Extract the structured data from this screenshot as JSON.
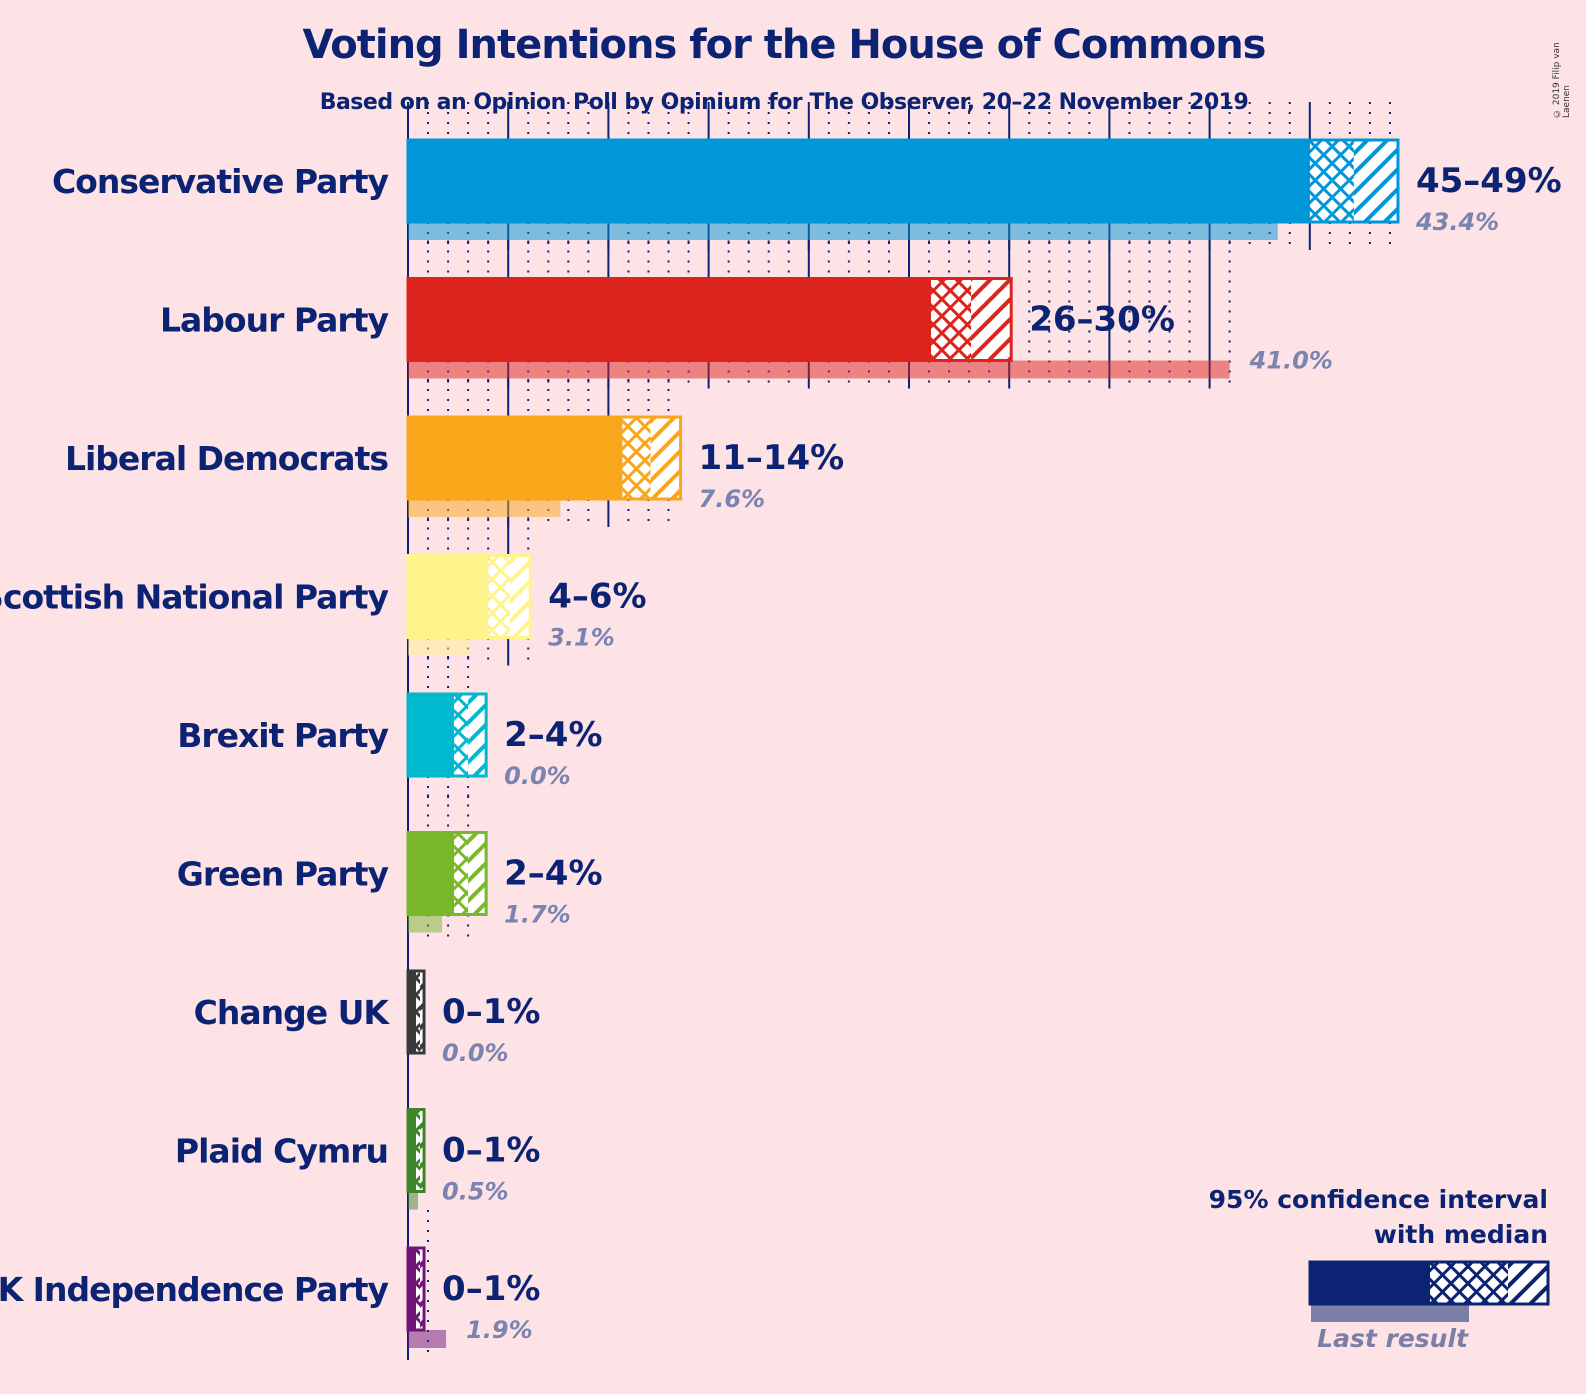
{
  "title": "Voting Intentions for the House of Commons",
  "subtitle": "Based on an Opinion Poll by Opinium for The Observer, 20–22 November 2019",
  "copyright": "© 2019 Filip van Laenen",
  "legend": {
    "title_line1": "95% confidence interval",
    "title_line2": "with median",
    "last_result": "Last result"
  },
  "chart_data": {
    "type": "bar",
    "orientation": "horizontal",
    "xlim": [
      0,
      50
    ],
    "grid": "dotted every 1%, solid every 5%",
    "series": [
      {
        "party": "Conservative Party",
        "color": "#0096d8",
        "low": 45.0,
        "median": 47.2,
        "high": 49.4,
        "range_label": "45–49%",
        "last": 43.4,
        "last_label": "43.4%"
      },
      {
        "party": "Labour Party",
        "color": "#dc241f",
        "low": 26.1,
        "median": 28.1,
        "high": 30.1,
        "range_label": "26–30%",
        "last": 41.0,
        "last_label": "41.0%"
      },
      {
        "party": "Liberal Democrats",
        "color": "#faa61a",
        "low": 10.7,
        "median": 12.1,
        "high": 13.6,
        "range_label": "11–14%",
        "last": 7.6,
        "last_label": "7.6%"
      },
      {
        "party": "Scottish National Party",
        "color": "#fff48c",
        "low": 4.0,
        "median": 5.1,
        "high": 6.1,
        "range_label": "4–6%",
        "last": 3.1,
        "last_label": "3.1%"
      },
      {
        "party": "Brexit Party",
        "color": "#00b9cf",
        "low": 2.3,
        "median": 3.0,
        "high": 3.9,
        "range_label": "2–4%",
        "last": 0.0,
        "last_label": "0.0%"
      },
      {
        "party": "Green Party",
        "color": "#78b82a",
        "low": 2.3,
        "median": 3.0,
        "high": 3.9,
        "range_label": "2–4%",
        "last": 1.7,
        "last_label": "1.7%"
      },
      {
        "party": "Change UK",
        "color": "#3a3a3a",
        "low": 0.4,
        "median": 0.6,
        "high": 0.8,
        "range_label": "0–1%",
        "last": 0.0,
        "last_label": "0.0%"
      },
      {
        "party": "Plaid Cymru",
        "color": "#3f8428",
        "low": 0.4,
        "median": 0.6,
        "high": 0.8,
        "range_label": "0–1%",
        "last": 0.5,
        "last_label": "0.5%"
      },
      {
        "party": "UK Independence Party",
        "color": "#70147a",
        "low": 0.4,
        "median": 0.6,
        "high": 0.8,
        "range_label": "0–1%",
        "last": 1.9,
        "last_label": "1.9%"
      }
    ]
  }
}
